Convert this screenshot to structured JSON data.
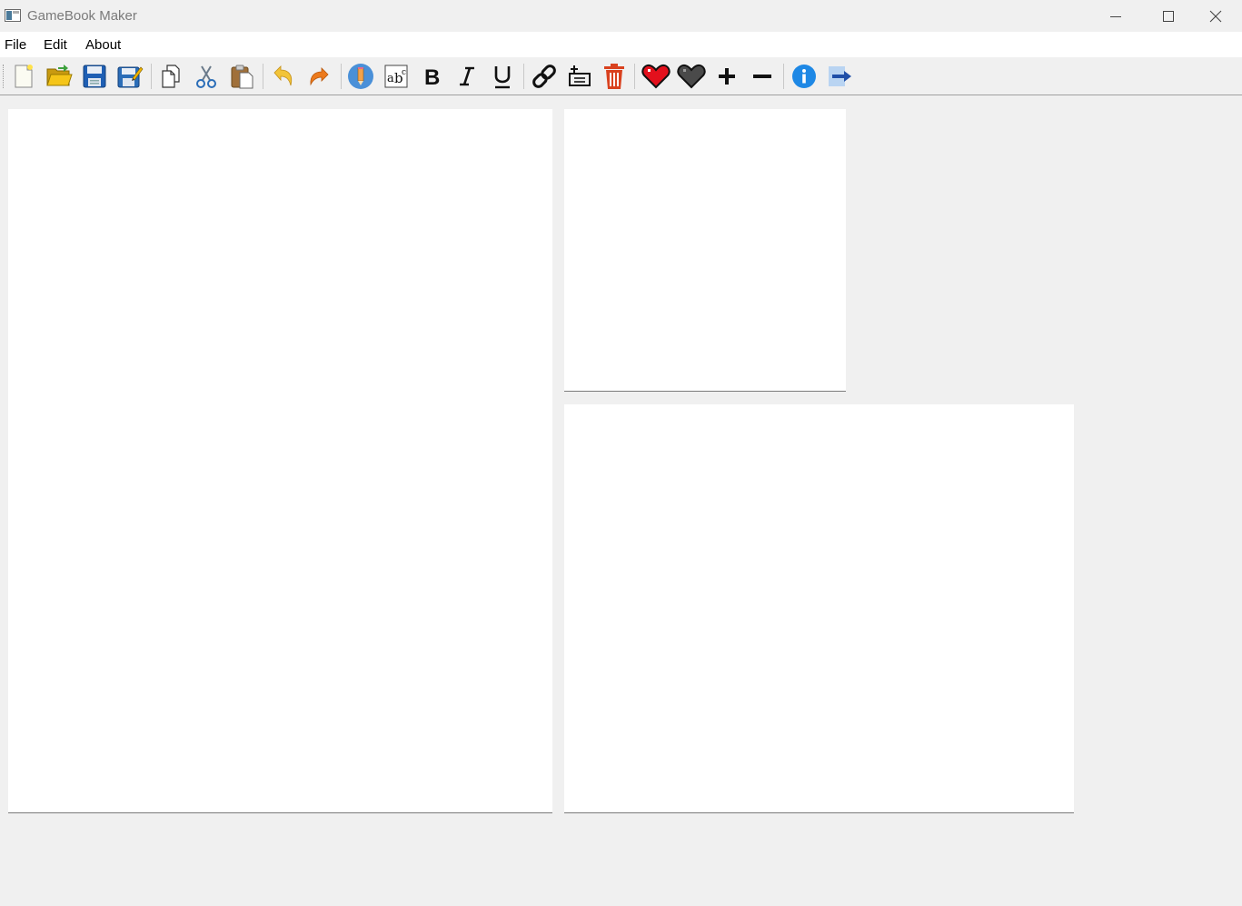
{
  "window": {
    "title": "GameBook Maker",
    "controls": [
      "minimize-icon",
      "maximize-icon",
      "close-icon"
    ]
  },
  "menu": {
    "items": [
      "File",
      "Edit",
      "About"
    ]
  },
  "toolbar": {
    "buttons": [
      {
        "icon": "new-file-icon"
      },
      {
        "icon": "open-folder-icon"
      },
      {
        "icon": "save-icon"
      },
      {
        "icon": "save-as-icon"
      },
      {
        "icon": "copy-icon"
      },
      {
        "icon": "cut-icon"
      },
      {
        "icon": "paste-icon"
      },
      {
        "icon": "undo-icon"
      },
      {
        "icon": "redo-icon"
      },
      {
        "icon": "edit-pencil-icon"
      },
      {
        "icon": "spell-check-icon"
      },
      {
        "icon": "bold-icon"
      },
      {
        "icon": "italic-icon"
      },
      {
        "icon": "underline-icon"
      },
      {
        "icon": "link-icon"
      },
      {
        "icon": "add-text-icon"
      },
      {
        "icon": "delete-icon"
      },
      {
        "icon": "heart-full-icon"
      },
      {
        "icon": "heart-empty-icon"
      },
      {
        "icon": "plus-icon"
      },
      {
        "icon": "minus-icon"
      },
      {
        "icon": "info-icon"
      },
      {
        "icon": "go-arrow-icon"
      }
    ]
  },
  "colors": {
    "background": "#f0f0f0",
    "panel": "#ffffff",
    "heart": "#e3101c",
    "info": "#1e88e5",
    "delete": "#d9411e",
    "folder": "#f5c518",
    "save": "#1f5fb4"
  }
}
